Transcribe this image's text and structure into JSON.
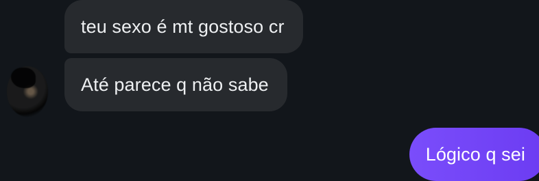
{
  "conversation": {
    "messages": [
      {
        "direction": "incoming",
        "text": "teu sexo é mt gostoso cr"
      },
      {
        "direction": "incoming",
        "text": "Até parece q não sabe"
      },
      {
        "direction": "outgoing",
        "text": "Lógico q sei"
      }
    ],
    "colors": {
      "background": "#12161b",
      "incoming_bubble": "#272a2e",
      "outgoing_bubble": "#7346f8",
      "incoming_text": "#eef0f2",
      "outgoing_text": "#ffffff"
    }
  }
}
